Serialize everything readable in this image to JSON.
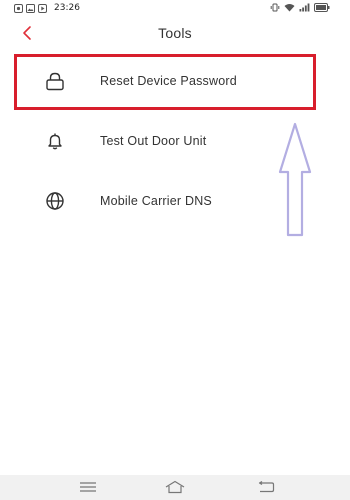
{
  "status_bar": {
    "time": "23:26"
  },
  "header": {
    "title": "Tools",
    "back_icon": "chevron-left-icon"
  },
  "menu": {
    "items": [
      {
        "label": "Reset Device Password",
        "icon": "lock-icon",
        "highlighted": true
      },
      {
        "label": "Test Out Door Unit",
        "icon": "bell-icon",
        "highlighted": false
      },
      {
        "label": "Mobile Carrier DNS",
        "icon": "globe-icon",
        "highlighted": false
      }
    ]
  },
  "nav_bar": {
    "icons": [
      "menu-icon",
      "home-icon",
      "back-icon"
    ]
  },
  "colors": {
    "accent": "#d81e2c",
    "annotation_arrow": "#b3aee2",
    "text": "#333333",
    "nav_background": "#f1f1f1"
  }
}
